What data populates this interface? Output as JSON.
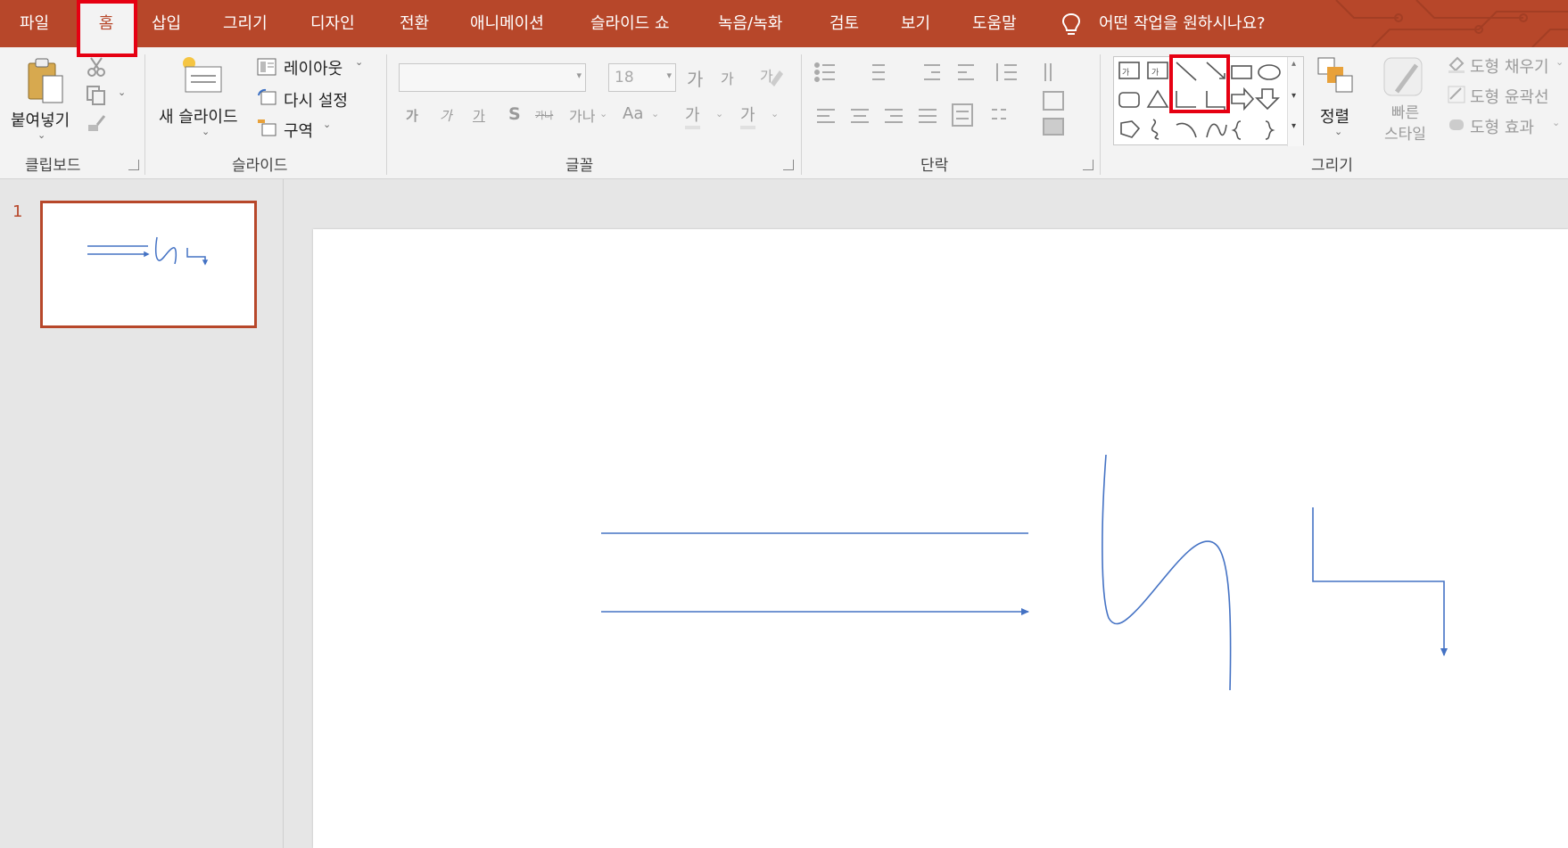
{
  "tabs": [
    {
      "label": "파일"
    },
    {
      "label": "홈"
    },
    {
      "label": "삽입"
    },
    {
      "label": "그리기"
    },
    {
      "label": "디자인"
    },
    {
      "label": "전환"
    },
    {
      "label": "애니메이션"
    },
    {
      "label": "슬라이드 쇼"
    },
    {
      "label": "녹음/녹화"
    },
    {
      "label": "검토"
    },
    {
      "label": "보기"
    },
    {
      "label": "도움말"
    }
  ],
  "active_tab": "홈",
  "tell_me": "어떤 작업을 원하시나요?",
  "clipboard": {
    "group_label": "클립보드",
    "paste_label": "붙여넣기"
  },
  "slides_group": {
    "group_label": "슬라이드",
    "new_slide_label": "새 슬라이드",
    "layout_label": "레이아웃",
    "reset_label": "다시 설정",
    "section_label": "구역"
  },
  "font_group": {
    "group_label": "글꼴",
    "font_name_value": "",
    "font_size_value": "18",
    "grow_label": "가",
    "shrink_label": "가",
    "bold_label": "가",
    "italic_label": "가",
    "underline_label": "가",
    "shadow_label": "S",
    "strike_label": "가나",
    "spacing_label": "Aa",
    "clear_label": "가",
    "highlight_label": "가",
    "color_label": "가"
  },
  "paragraph_group": {
    "group_label": "단락"
  },
  "drawing_group": {
    "group_label": "그리기",
    "arrange_label": "정렬",
    "quick_styles_label": "빠른\n스타일",
    "fill_label": "도형 채우기",
    "outline_label": "도형 윤곽선",
    "effects_label": "도형 효과"
  },
  "slide_panel": {
    "slide_number": "1"
  },
  "colors": {
    "accent": "#b7472a",
    "line": "#4472c4",
    "highlight": "#e60012"
  }
}
